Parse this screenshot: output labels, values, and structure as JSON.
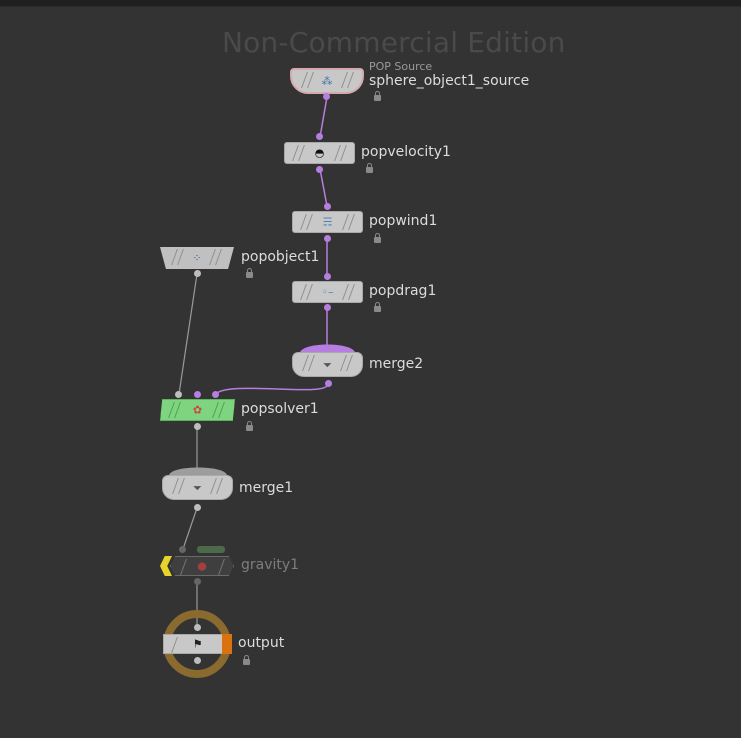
{
  "watermark": "Non-Commercial Edition",
  "nodes": {
    "sphere_source": {
      "type_label": "POP Source",
      "name": "sphere_object1_source"
    },
    "popvelocity": {
      "name": "popvelocity1"
    },
    "popwind": {
      "name": "popwind1"
    },
    "popobject": {
      "name": "popobject1"
    },
    "popdrag": {
      "name": "popdrag1"
    },
    "merge2": {
      "name": "merge2"
    },
    "popsolver": {
      "name": "popsolver1"
    },
    "merge1": {
      "name": "merge1"
    },
    "gravity": {
      "name": "gravity1",
      "bypassed": true
    },
    "output": {
      "name": "output",
      "display_flag": true
    }
  },
  "colors": {
    "background": "#333333",
    "wire_purple": "#b57ee0",
    "wire_gray": "#9a9a9a",
    "solver_green": "#7fd47f",
    "bypass_yellow": "#e8d32a",
    "output_ring": "#8a6a2e",
    "display_orange": "#d9720f"
  },
  "icons": {
    "sphere_source": "pop-source-icon",
    "popvelocity": "speedometer-icon",
    "popwind": "wind-icon",
    "popobject": "particles-icon",
    "popdrag": "drag-icon",
    "merge": "funnel-icon",
    "popsolver": "solver-icon",
    "gravity": "apple-icon",
    "output": "checkered-flag-icon"
  }
}
